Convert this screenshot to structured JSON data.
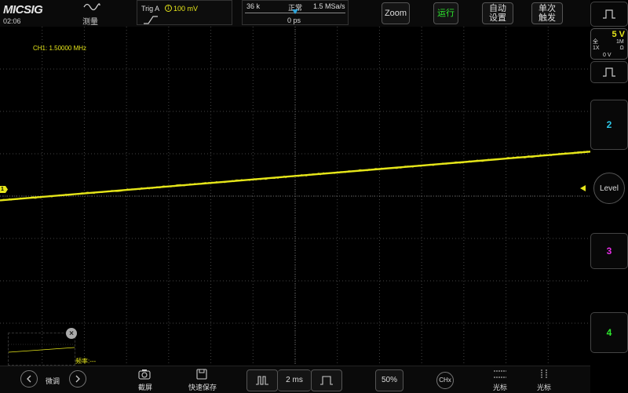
{
  "header": {
    "logo": "MICSIG",
    "clock": "02:06",
    "measure_label": "测量",
    "trigger": {
      "label": "Trig  A",
      "source": "1",
      "level": "100 mV"
    },
    "timebase": {
      "memory_depth": "36 k",
      "acq_mode": "正常",
      "sample_rate": "1.5 MSa/s",
      "delay": "0 ps"
    },
    "buttons": {
      "zoom": "Zoom",
      "run": "运行",
      "auto_line1": "自动",
      "auto_line2": "设置",
      "single_line1": "单次",
      "single_line2": "触发"
    }
  },
  "screen": {
    "ch1_freq": "CH1: 1.50000 MHz",
    "ch1_marker": "1",
    "overview_close": "×",
    "freq_text": "频率:---"
  },
  "sidebar": {
    "ch1": {
      "scale": "5 V",
      "coupling_line1": "全",
      "coupling_line2": "1X",
      "impedance_line1": "1M",
      "impedance_line2": "Ω",
      "offset": "0 V"
    },
    "ch2_label": "2",
    "ch3_label": "3",
    "ch4_label": "4",
    "level_label": "Level"
  },
  "bottom": {
    "fine_label": "微调",
    "screenshot_label": "截屏",
    "quick_save_label": "快速保存",
    "timebase_value": "2 ms",
    "trigger_pos": "50%",
    "chx_label": "CHx",
    "cursor_h_label": "光标",
    "cursor_v_label": "光标"
  },
  "colors": {
    "ch1": "#e6e61a",
    "ch2": "#2ec8e8",
    "ch3": "#e62ee6",
    "ch4": "#2ee82e",
    "run": "#2ee82e"
  },
  "trace": {
    "start_div": -0.1,
    "end_div": 1.05
  }
}
